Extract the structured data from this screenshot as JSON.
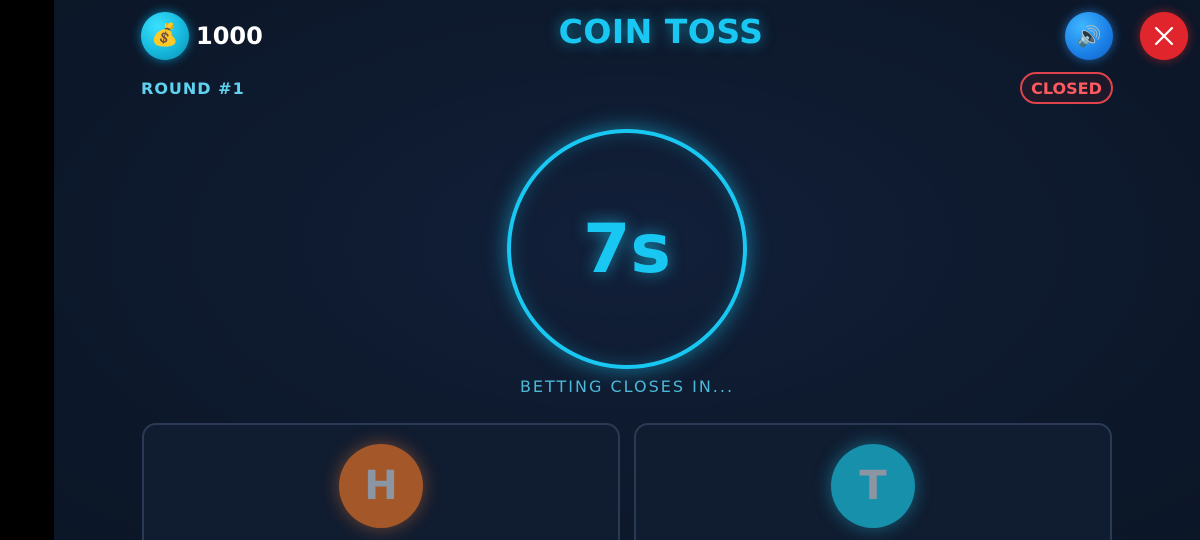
{
  "header": {
    "balance_icon": "money-bag-icon",
    "balance": "1000",
    "title": "COIN TOSS",
    "sound_icon": "speaker-icon",
    "close_icon": "close-icon"
  },
  "round": {
    "label": "ROUND #1",
    "status": "CLOSED"
  },
  "timer": {
    "value": "7s",
    "caption": "BETTING CLOSES IN..."
  },
  "bets": [
    {
      "letter": "H"
    },
    {
      "letter": "T"
    }
  ],
  "colors": {
    "accent": "#19c8f2",
    "background": "#0e1a2e",
    "heads": "#a4582a",
    "tails": "#1690ab",
    "closed": "#e0434b"
  }
}
